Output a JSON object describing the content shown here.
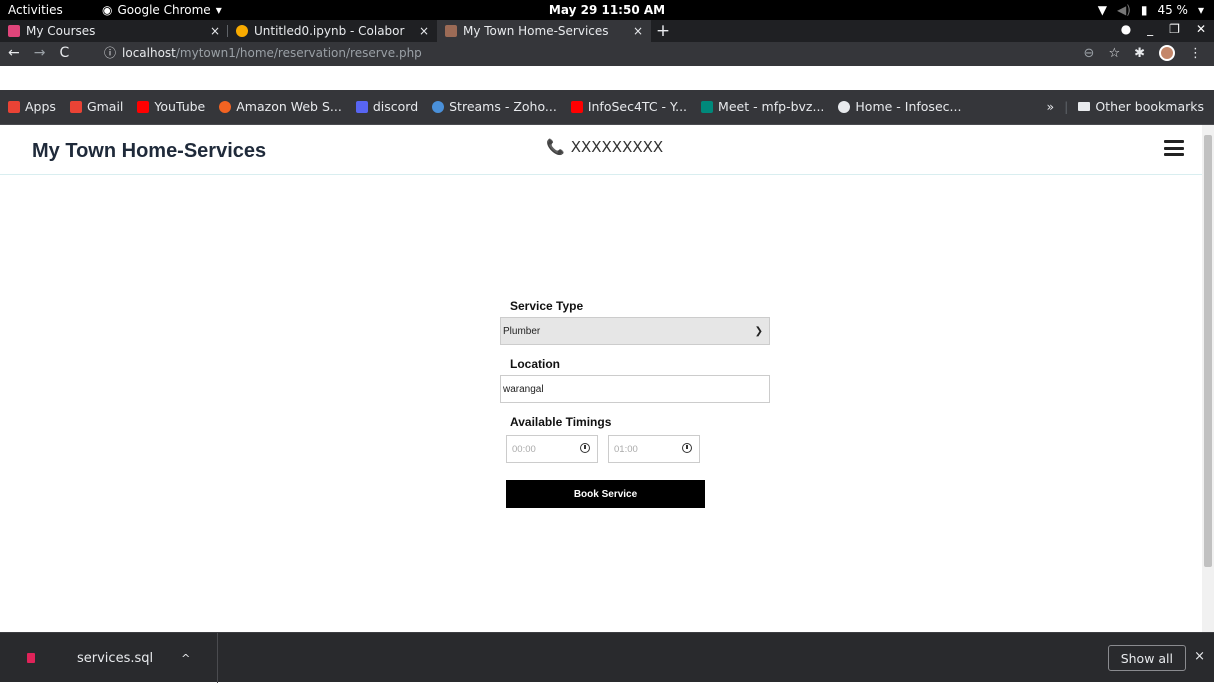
{
  "system_bar": {
    "activities": "Activities",
    "app_name": "Google Chrome",
    "clock": "May 29  11:50 AM",
    "battery": "45 %"
  },
  "tabs": [
    {
      "title": "My Courses",
      "close": "×",
      "favicon_color": "#e0457b"
    },
    {
      "title": "Untitled0.ipynb - Colabor",
      "close": "×",
      "favicon_color": "#f9ab00"
    },
    {
      "title": "My Town Home-Services",
      "close": "×",
      "favicon_color": "#9c6b56"
    }
  ],
  "new_tab": "+",
  "omnibox": {
    "host": "localhost",
    "path": "/mytown1/home/reservation/reserve.php"
  },
  "bookmarks": [
    {
      "label": "Apps",
      "color": "#ea4335"
    },
    {
      "label": "Gmail",
      "color": "#ea4335"
    },
    {
      "label": "YouTube",
      "color": "#ff0000"
    },
    {
      "label": "Amazon Web S...",
      "color": "#f26322"
    },
    {
      "label": "discord",
      "color": "#5865f2"
    },
    {
      "label": "Streams - Zoho...",
      "color": "#4a90d9"
    },
    {
      "label": "InfoSec4TC - Y...",
      "color": "#ff0000"
    },
    {
      "label": "Meet - mfp-bvz...",
      "color": "#00897b"
    },
    {
      "label": "Home - Infosec...",
      "color": "#e8eaed"
    }
  ],
  "bookmarks_overflow": "»",
  "other_bookmarks": "Other bookmarks",
  "site": {
    "brand": "My Town Home-Services",
    "phone": "XXXXXXXXX"
  },
  "form": {
    "service_type_label": "Service Type",
    "service_type_value": "Plumber",
    "location_label": "Location",
    "location_value": "warangal",
    "timings_label": "Available Timings",
    "time_from": "00:00",
    "time_to": "01:00",
    "submit_label": "Book Service"
  },
  "downloads": {
    "file": "services.sql",
    "show_all": "Show all",
    "close": "×"
  }
}
